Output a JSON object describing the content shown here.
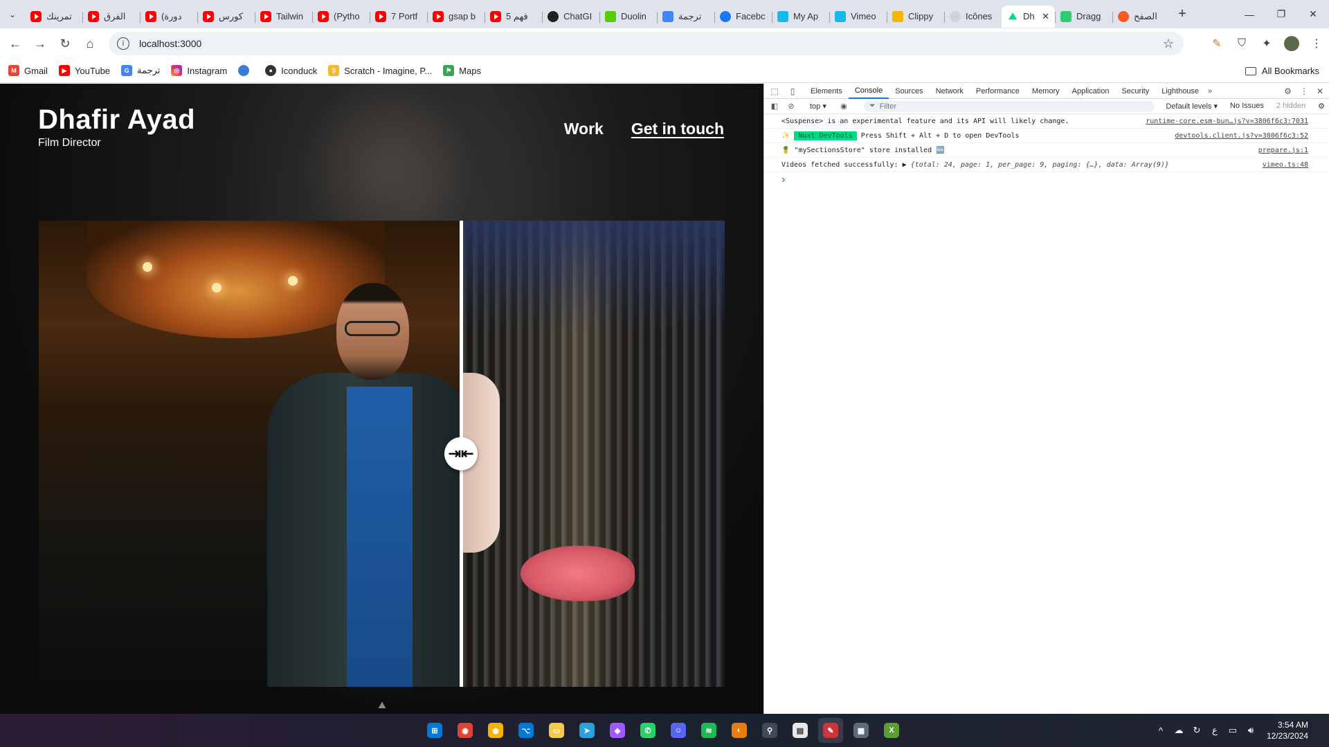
{
  "browser": {
    "tabs": [
      {
        "title": "تمرينك",
        "icon": "youtube-icon",
        "fav": "yt",
        "active": false
      },
      {
        "title": "الفرق",
        "icon": "youtube-icon",
        "fav": "yt",
        "active": false
      },
      {
        "title": "(دورة",
        "icon": "youtube-icon",
        "fav": "yt",
        "active": false
      },
      {
        "title": "كورس",
        "icon": "youtube-icon",
        "fav": "yt",
        "active": false
      },
      {
        "title": "Tailwin",
        "icon": "youtube-icon",
        "fav": "yt",
        "active": false
      },
      {
        "title": "(Pytho",
        "icon": "youtube-icon",
        "fav": "yt",
        "active": false
      },
      {
        "title": "7 Portf",
        "icon": "youtube-icon",
        "fav": "yt",
        "active": false
      },
      {
        "title": "gsap b",
        "icon": "youtube-icon",
        "fav": "yt",
        "active": false
      },
      {
        "title": "5 فهم",
        "icon": "youtube-icon",
        "fav": "yt",
        "active": false
      },
      {
        "title": "ChatGI",
        "icon": "chatgpt-icon",
        "fav": "gpt",
        "active": false
      },
      {
        "title": "Duolin",
        "icon": "duolingo-icon",
        "fav": "duo",
        "active": false
      },
      {
        "title": "ترجمة",
        "icon": "translate-icon",
        "fav": "tr",
        "active": false
      },
      {
        "title": "Facebc",
        "icon": "facebook-icon",
        "fav": "fb",
        "active": false
      },
      {
        "title": "My Ap",
        "icon": "vimeo-icon",
        "fav": "vim",
        "active": false
      },
      {
        "title": "Vimeo",
        "icon": "vimeo-icon",
        "fav": "vim",
        "active": false
      },
      {
        "title": "Clippy",
        "icon": "clippy-icon",
        "fav": "clip",
        "active": false
      },
      {
        "title": "Icônes",
        "icon": "icones-icon",
        "fav": "ic",
        "active": false
      },
      {
        "title": "Dh",
        "icon": "nuxt-icon",
        "fav": "nuxt",
        "active": true
      },
      {
        "title": "Dragg",
        "icon": "draggable-icon",
        "fav": "drag",
        "active": false
      },
      {
        "title": "الصفح",
        "icon": "page-icon",
        "fav": "ar",
        "active": false
      }
    ],
    "url": "localhost:3000",
    "bookmarks": [
      {
        "label": "Gmail",
        "icon": "gmail-icon",
        "cls": "gm",
        "glyph": "M"
      },
      {
        "label": "YouTube",
        "icon": "youtube-icon",
        "cls": "yt",
        "glyph": "▶"
      },
      {
        "label": "ترجمة",
        "icon": "translate-icon",
        "cls": "tr",
        "glyph": "G"
      },
      {
        "label": "Instagram",
        "icon": "instagram-icon",
        "cls": "ig",
        "glyph": "◎"
      },
      {
        "label": "",
        "icon": "edge-icon",
        "cls": "ed",
        "glyph": ""
      },
      {
        "label": "Iconduck",
        "icon": "iconduck-icon",
        "cls": "icd",
        "glyph": "●"
      },
      {
        "label": "Scratch - Imagine, P...",
        "icon": "scratch-icon",
        "cls": "scr",
        "glyph": "S"
      },
      {
        "label": "Maps",
        "icon": "maps-icon",
        "cls": "map",
        "glyph": "⚑"
      }
    ],
    "all_bookmarks": "All Bookmarks"
  },
  "site": {
    "name": "Dhafir Ayad",
    "role": "Film Director",
    "nav": [
      {
        "label": "Work",
        "underline": false
      },
      {
        "label": "Get in touch",
        "underline": true
      }
    ],
    "compare_handle_icon": "arrows-compress-icon"
  },
  "devtools": {
    "tabs": [
      "Elements",
      "Console",
      "Sources",
      "Network",
      "Performance",
      "Memory",
      "Application",
      "Security",
      "Lighthouse"
    ],
    "active_tab": "Console",
    "context": "top ▾",
    "filter_placeholder": "Filter",
    "levels": "Default levels ▾",
    "issues": "No Issues",
    "hidden": "2 hidden",
    "logs": [
      {
        "prefix": "",
        "badge": "",
        "text": "<Suspense> is an experimental feature and its API will likely change.",
        "obj": "",
        "source": "runtime-core.esm-bun…js?v=3806f6c3:7031"
      },
      {
        "prefix": "✨",
        "badge": "Nuxt DevTools",
        "text": "Press Shift + Alt + D to open DevTools",
        "obj": "",
        "source": "devtools.client.js?v=3806f6c3:52"
      },
      {
        "prefix": "🍍",
        "badge": "",
        "text": "\"mySectionsStore\" store installed 🆕",
        "obj": "",
        "source": "prepare.js:1"
      },
      {
        "prefix": "",
        "badge": "",
        "text": "Videos fetched successfully: ▶",
        "obj": "{total: 24, page: 1, per_page: 9, paging: {…}, data: Array(9)}",
        "source": "vimeo.ts:48"
      }
    ]
  },
  "taskbar": {
    "apps": [
      {
        "name": "windows-start-icon",
        "glyph": "⊞",
        "bg": "#0078d4"
      },
      {
        "name": "chrome-icon",
        "glyph": "◉",
        "bg": "#db4437"
      },
      {
        "name": "chrome-profile-icon",
        "glyph": "◉",
        "bg": "#f4b400"
      },
      {
        "name": "vscode-icon",
        "glyph": "⌥",
        "bg": "#0078d7"
      },
      {
        "name": "file-explorer-icon",
        "glyph": "▭",
        "bg": "#f7c948"
      },
      {
        "name": "telegram-icon",
        "glyph": "➤",
        "bg": "#2aa3dd"
      },
      {
        "name": "figma-icon",
        "glyph": "◆",
        "bg": "#a259ff"
      },
      {
        "name": "whatsapp-icon",
        "glyph": "✆",
        "bg": "#25d366"
      },
      {
        "name": "discord-icon",
        "glyph": "☺",
        "bg": "#5865f2"
      },
      {
        "name": "spotify-icon",
        "glyph": "≋",
        "bg": "#1db954"
      },
      {
        "name": "blender-icon",
        "glyph": "◐",
        "bg": "#e87d0d"
      },
      {
        "name": "search-app-icon",
        "glyph": "⚲",
        "bg": "#444a55"
      },
      {
        "name": "notepad-icon",
        "glyph": "▤",
        "bg": "#e8e8e8"
      },
      {
        "name": "paint-icon",
        "glyph": "✎",
        "bg": "#d13438"
      },
      {
        "name": "calculator-icon",
        "glyph": "▦",
        "bg": "#5d6a7a"
      },
      {
        "name": "excel-icon",
        "glyph": "X",
        "bg": "#5c9e31"
      }
    ],
    "time": "3:54 AM",
    "date": "12/23/2024",
    "lang": "ع"
  }
}
